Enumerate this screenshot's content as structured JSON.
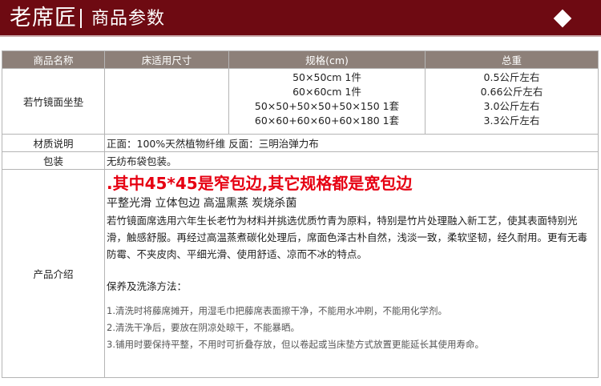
{
  "header": {
    "brand": "老席匠",
    "subtitle": "商品参数"
  },
  "table": {
    "headers": [
      "商品名称",
      "床适用尺寸",
      "规格(cm)",
      "总重"
    ],
    "product_name": "若竹镜面坐垫",
    "bed_size": "",
    "specs": [
      "50×50cm 1件",
      "60×60cm 1件",
      "50×50+50×50+50×150 1套",
      "60×60+60×60+60×180 1套"
    ],
    "weights": [
      "0.5公斤左右",
      "0.66公斤左右",
      "3.0公斤左右",
      "3.3公斤左右"
    ],
    "material": {
      "label": "材质说明",
      "value": "正面：100%天然植物纤维  反面：三明治弹力布"
    },
    "packaging": {
      "label": "包装",
      "value": "无纺布袋包装。"
    },
    "intro": {
      "label": "产品介绍",
      "warning": ".其中45*45是窄包边,其它规格都是宽包边",
      "features": "平整光滑 立体包边 高温熏蒸 炭烧杀菌",
      "description": "若竹镜面席选用六年生长老竹为材料并挑选优质竹青为原料，特别是竹片处理融入新工艺，使其表面特别光滑，触感舒服。再经过高温蒸煮碳化处理后，席面色泽古朴自然，浅淡一致，柔软坚韧，经久耐用。更有无毒防霉、不夹皮肉、平细光滑、使用舒适、凉而不冰的特点。",
      "care_title": "保养及洗涤方法：",
      "care_items": [
        "1.清洗时将藤席摊开，用湿毛巾把藤席表面擦干净，不能用水冲刷，不能用化学剂。",
        "2.清洗干净后，要放在阴凉处晾干，不能暴晒。",
        "3.铺用时要保持平整，不用时可折叠存放，但以卷起或当床垫方式放置更能延长其使用寿命。"
      ]
    }
  },
  "colors": {
    "header_bg": "#6e0a12",
    "table_header_bg": "#8d8079",
    "warning": "#e60012"
  }
}
